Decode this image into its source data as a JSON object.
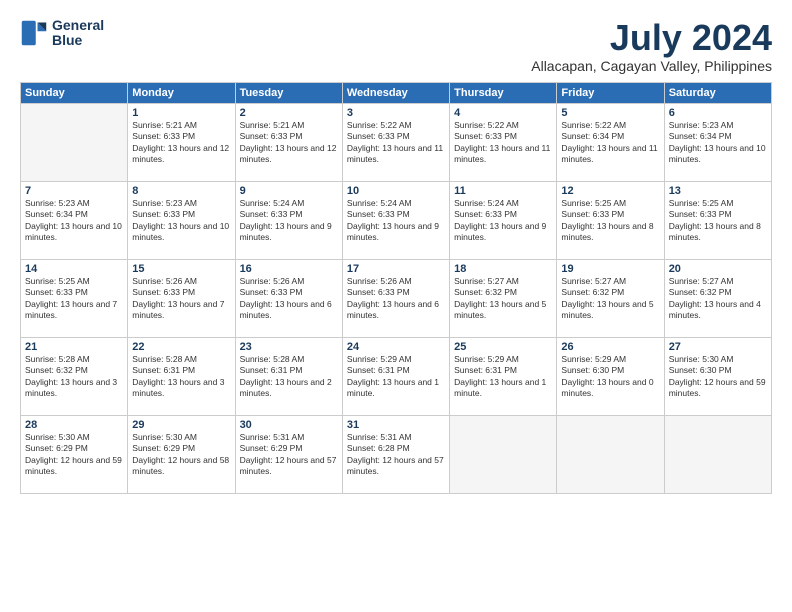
{
  "header": {
    "logo_line1": "General",
    "logo_line2": "Blue",
    "month": "July 2024",
    "location": "Allacapan, Cagayan Valley, Philippines"
  },
  "weekdays": [
    "Sunday",
    "Monday",
    "Tuesday",
    "Wednesday",
    "Thursday",
    "Friday",
    "Saturday"
  ],
  "weeks": [
    [
      {
        "day": "",
        "empty": true
      },
      {
        "day": "1",
        "rise": "5:21 AM",
        "set": "6:33 PM",
        "daylight": "13 hours and 12 minutes."
      },
      {
        "day": "2",
        "rise": "5:21 AM",
        "set": "6:33 PM",
        "daylight": "13 hours and 12 minutes."
      },
      {
        "day": "3",
        "rise": "5:22 AM",
        "set": "6:33 PM",
        "daylight": "13 hours and 11 minutes."
      },
      {
        "day": "4",
        "rise": "5:22 AM",
        "set": "6:33 PM",
        "daylight": "13 hours and 11 minutes."
      },
      {
        "day": "5",
        "rise": "5:22 AM",
        "set": "6:34 PM",
        "daylight": "13 hours and 11 minutes."
      },
      {
        "day": "6",
        "rise": "5:23 AM",
        "set": "6:34 PM",
        "daylight": "13 hours and 10 minutes."
      }
    ],
    [
      {
        "day": "7",
        "rise": "5:23 AM",
        "set": "6:34 PM",
        "daylight": "13 hours and 10 minutes."
      },
      {
        "day": "8",
        "rise": "5:23 AM",
        "set": "6:33 PM",
        "daylight": "13 hours and 10 minutes."
      },
      {
        "day": "9",
        "rise": "5:24 AM",
        "set": "6:33 PM",
        "daylight": "13 hours and 9 minutes."
      },
      {
        "day": "10",
        "rise": "5:24 AM",
        "set": "6:33 PM",
        "daylight": "13 hours and 9 minutes."
      },
      {
        "day": "11",
        "rise": "5:24 AM",
        "set": "6:33 PM",
        "daylight": "13 hours and 9 minutes."
      },
      {
        "day": "12",
        "rise": "5:25 AM",
        "set": "6:33 PM",
        "daylight": "13 hours and 8 minutes."
      },
      {
        "day": "13",
        "rise": "5:25 AM",
        "set": "6:33 PM",
        "daylight": "13 hours and 8 minutes."
      }
    ],
    [
      {
        "day": "14",
        "rise": "5:25 AM",
        "set": "6:33 PM",
        "daylight": "13 hours and 7 minutes."
      },
      {
        "day": "15",
        "rise": "5:26 AM",
        "set": "6:33 PM",
        "daylight": "13 hours and 7 minutes."
      },
      {
        "day": "16",
        "rise": "5:26 AM",
        "set": "6:33 PM",
        "daylight": "13 hours and 6 minutes."
      },
      {
        "day": "17",
        "rise": "5:26 AM",
        "set": "6:33 PM",
        "daylight": "13 hours and 6 minutes."
      },
      {
        "day": "18",
        "rise": "5:27 AM",
        "set": "6:32 PM",
        "daylight": "13 hours and 5 minutes."
      },
      {
        "day": "19",
        "rise": "5:27 AM",
        "set": "6:32 PM",
        "daylight": "13 hours and 5 minutes."
      },
      {
        "day": "20",
        "rise": "5:27 AM",
        "set": "6:32 PM",
        "daylight": "13 hours and 4 minutes."
      }
    ],
    [
      {
        "day": "21",
        "rise": "5:28 AM",
        "set": "6:32 PM",
        "daylight": "13 hours and 3 minutes."
      },
      {
        "day": "22",
        "rise": "5:28 AM",
        "set": "6:31 PM",
        "daylight": "13 hours and 3 minutes."
      },
      {
        "day": "23",
        "rise": "5:28 AM",
        "set": "6:31 PM",
        "daylight": "13 hours and 2 minutes."
      },
      {
        "day": "24",
        "rise": "5:29 AM",
        "set": "6:31 PM",
        "daylight": "13 hours and 1 minute."
      },
      {
        "day": "25",
        "rise": "5:29 AM",
        "set": "6:31 PM",
        "daylight": "13 hours and 1 minute."
      },
      {
        "day": "26",
        "rise": "5:29 AM",
        "set": "6:30 PM",
        "daylight": "13 hours and 0 minutes."
      },
      {
        "day": "27",
        "rise": "5:30 AM",
        "set": "6:30 PM",
        "daylight": "12 hours and 59 minutes."
      }
    ],
    [
      {
        "day": "28",
        "rise": "5:30 AM",
        "set": "6:29 PM",
        "daylight": "12 hours and 59 minutes."
      },
      {
        "day": "29",
        "rise": "5:30 AM",
        "set": "6:29 PM",
        "daylight": "12 hours and 58 minutes."
      },
      {
        "day": "30",
        "rise": "5:31 AM",
        "set": "6:29 PM",
        "daylight": "12 hours and 57 minutes."
      },
      {
        "day": "31",
        "rise": "5:31 AM",
        "set": "6:28 PM",
        "daylight": "12 hours and 57 minutes."
      },
      {
        "day": "",
        "empty": true
      },
      {
        "day": "",
        "empty": true
      },
      {
        "day": "",
        "empty": true
      }
    ]
  ]
}
